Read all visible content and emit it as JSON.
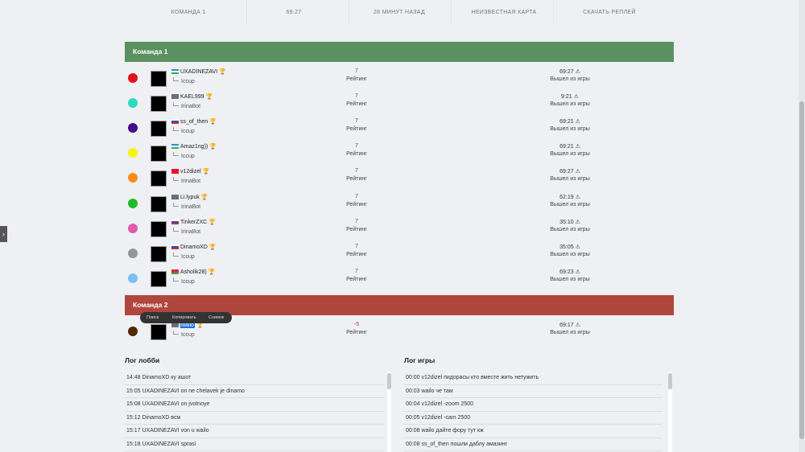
{
  "top": {
    "team": "КОМАНДА 1",
    "duration": "69:27",
    "ago": "28 МИНУТ НАЗАД",
    "map": "НЕИЗВЕСТНАЯ КАРТА",
    "download": "СКАЧАТЬ РЕПЛЕЙ"
  },
  "team1": {
    "name": "Команда 1",
    "players": [
      {
        "name": "UXADINEZAVI",
        "lobby": "Iccup",
        "rating": "7",
        "rating_label": "Рейтинг",
        "time": "69:27",
        "status": "Вышел из игры",
        "color": "#e5111b",
        "flag": "uz"
      },
      {
        "name": "KAEL999",
        "lobby": "IrinaBot",
        "rating": "7",
        "rating_label": "Рейтинг",
        "time": "9:21",
        "status": "Вышел из игры",
        "color": "#2fd8bf",
        "flag": "na"
      },
      {
        "name": "ss_of_then",
        "lobby": "Iccup",
        "rating": "7",
        "rating_label": "Рейтинг",
        "time": "69:21",
        "status": "Вышел из игры",
        "color": "#4b0a8a",
        "flag": "ru"
      },
      {
        "name": "Amaz1ng))",
        "lobby": "Iccup",
        "rating": "7",
        "rating_label": "Рейтинг",
        "time": "69:21",
        "status": "Вышел из игры",
        "color": "#f5f218",
        "flag": "uz"
      },
      {
        "name": "v12dizel",
        "lobby": "IrinaBot",
        "rating": "7",
        "rating_label": "Рейтинг",
        "time": "69:27",
        "status": "Вышел из игры",
        "color": "#fa8c1b",
        "flag": "kg"
      },
      {
        "name": "Li.lypuk",
        "lobby": "IrinaBot",
        "rating": "7",
        "rating_label": "Рейтинг",
        "time": "62:19",
        "status": "Вышел из игры",
        "color": "#1fb92a",
        "flag": "na"
      },
      {
        "name": "TinkerZXC",
        "lobby": "IrinaBot",
        "rating": "7",
        "rating_label": "Рейтинг",
        "time": "35:10",
        "status": "Вышел из игры",
        "color": "#e35ab1",
        "flag": "ru"
      },
      {
        "name": "DinamoXD",
        "lobby": "Iccup",
        "rating": "7",
        "rating_label": "Рейтинг",
        "time": "35:05",
        "status": "Вышел из игры",
        "color": "#959697",
        "flag": "ru"
      },
      {
        "name": "Asholik28)",
        "lobby": "Iccup",
        "rating": "7",
        "rating_label": "Рейтинг",
        "time": "69:23",
        "status": "Вышел из игры",
        "color": "#7dbef1",
        "flag": "by"
      }
    ]
  },
  "team2": {
    "name": "Команда 2",
    "players": [
      {
        "name": "wailo",
        "lobby": "Iccup",
        "rating": "-5",
        "rating_label": "Рейтинг",
        "time": "69:17",
        "status": "Вышел из игры",
        "color": "#4e2a04",
        "flag": "na"
      }
    ]
  },
  "context_menu": {
    "search": "Поиск",
    "copy": "Копировать",
    "snapshot": "Снимок"
  },
  "lobby_log": {
    "title": "Лог лобби",
    "lines": [
      "14:48 DinamoXD ку ашот",
      "15:05 UXADINEZAVI on ne chelavek je dinamo",
      "15:08 UXADINEZAVI on jvotnoye",
      "15:12 DinamoXD всм",
      "15:17 UXADINEZAVI von u wailo",
      "15:18 UXADINEZAVI sprasi"
    ]
  },
  "game_log": {
    "title": "Лог игры",
    "lines": [
      "00:00 v12dizel пидорасы кто вместе жить нетужить",
      "00:03 wailo че там",
      "00:04 v12dizel -zoom 2500",
      "00:05 v12dizel -cam 2500",
      "00:08 wailo дайте фору тут кж",
      "00:08 ss_of_then пошли даблу амазинг"
    ]
  }
}
